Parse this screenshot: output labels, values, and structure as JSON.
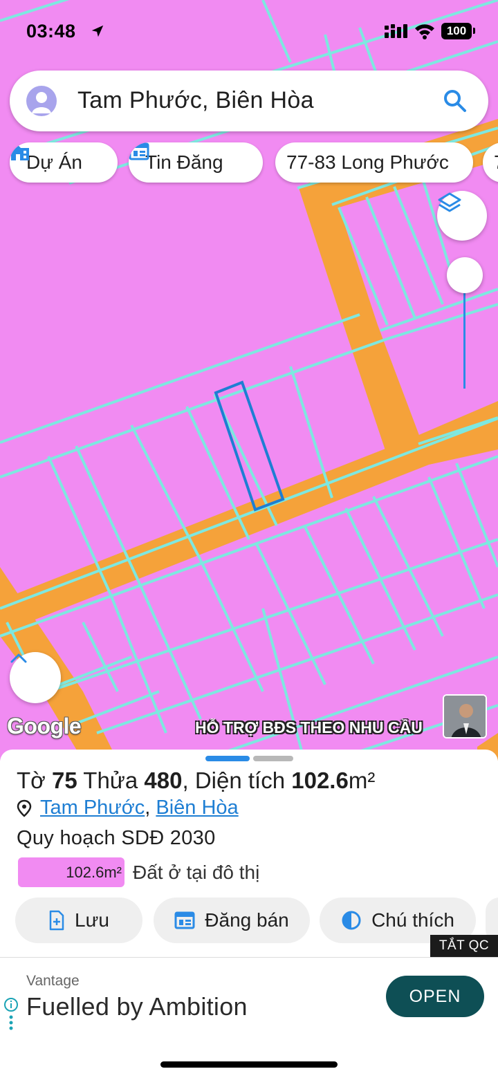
{
  "status_bar": {
    "time": "03:48",
    "battery": "100",
    "location_icon": "location-arrow-icon",
    "signal_icon": "cellular-signal-icon",
    "wifi_icon": "wifi-icon"
  },
  "search": {
    "query": "Tam Phước, Biên Hòa",
    "avatar_icon": "user-avatar-icon",
    "search_icon": "search-icon"
  },
  "chips": [
    {
      "label": "Dự Án",
      "icon": "building-icon"
    },
    {
      "label": "Tin Đăng",
      "icon": "listing-icon"
    },
    {
      "label": "77-83 Long Phước",
      "icon": ""
    },
    {
      "label": "7",
      "icon": ""
    }
  ],
  "map": {
    "layers_icon": "layers-icon",
    "collapse_icon": "chevron-up-icon",
    "google_logo": "Google",
    "promo_text": "HỖ TRỢ BĐS  THEO NHU CẦU",
    "opacity_level": 1.0,
    "colors": {
      "land": "#f18bf2",
      "road": "#f5a23a",
      "parcel_border": "#7ee8e0",
      "selected_parcel": "#1e7ed3"
    }
  },
  "sheet": {
    "to_label": "Tờ",
    "to_number": "75",
    "thua_label": "Thửa",
    "thua_number": "480",
    "area_label": "Diện tích",
    "area_value": "102.6",
    "area_unit": "m²",
    "location_icon": "map-pin-icon",
    "ward": "Tam Phước",
    "separator": ",",
    "city": "Biên Hòa",
    "plan": "Quy hoạch SDĐ 2030",
    "land_area": "102.6m²",
    "land_type": "Đất ở tại đô thị",
    "actions": [
      {
        "label": "Lưu",
        "icon": "add-file-icon"
      },
      {
        "label": "Đăng bán",
        "icon": "listing-icon"
      },
      {
        "label": "Chú thích",
        "icon": "contrast-icon"
      }
    ]
  },
  "ad": {
    "close_label": "TẮT QC",
    "brand": "Vantage",
    "headline": "Fuelled by Ambition",
    "cta": "OPEN",
    "info_icon": "info-icon"
  }
}
